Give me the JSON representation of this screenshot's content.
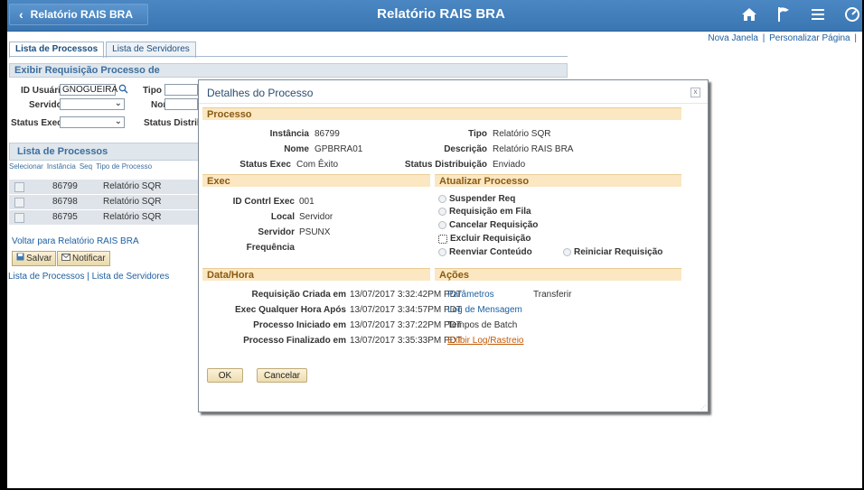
{
  "app": {
    "back_label": "Relatório RAIS BRA",
    "title": "Relatório RAIS BRA",
    "icons": [
      "home-icon",
      "flag-icon",
      "menu-icon",
      "navbar-icon"
    ]
  },
  "top_links": {
    "new_window": "Nova Janela",
    "separator": "|",
    "personalize": "Personalizar Página",
    "trailing": "|"
  },
  "tabs": [
    {
      "label": "Lista de Processos",
      "active": true
    },
    {
      "label": "Lista de Servidores",
      "active": false
    }
  ],
  "background_page": {
    "section_title": "Exibir Requisição Processo de",
    "fields": {
      "user_id_label": "ID Usuário",
      "user_id_value": "GNOGUEIRA",
      "type_label": "Tipo",
      "server_label": "Servidor",
      "name_label": "Nome",
      "status_exec_label": "Status Exec",
      "status_dist_label": "Status Distribu"
    },
    "list": {
      "title": "Lista de Processos",
      "columns": [
        "Selecionar",
        "Instância",
        "Seq",
        "Tipo de Processo"
      ],
      "rows": [
        {
          "instance": "86799",
          "type": "Relatório SQR"
        },
        {
          "instance": "86798",
          "type": "Relatório SQR"
        },
        {
          "instance": "86795",
          "type": "Relatório SQR"
        }
      ]
    },
    "back_link": "Voltar para Relatório RAIS BRA",
    "save_label": "Salvar",
    "notify_label": "Notificar",
    "bottom_links": "Lista de Processos | Lista de Servidores"
  },
  "modal": {
    "title": "Detalhes do Processo",
    "close": "x",
    "process": {
      "header": "Processo",
      "instance_label": "Instância",
      "instance_value": "86799",
      "type_label": "Tipo",
      "type_value": "Relatório SQR",
      "name_label": "Nome",
      "name_value": "GPBRRA01",
      "description_label": "Descrição",
      "description_value": "Relatório RAIS BRA",
      "status_exec_label": "Status Exec",
      "status_exec_value": "Com Êxito",
      "status_dist_label": "Status Distribuição",
      "status_dist_value": "Enviado"
    },
    "exec": {
      "header": "Exec",
      "id_label": "ID Contrl Exec",
      "id_value": "001",
      "local_label": "Local",
      "local_value": "Servidor",
      "server_label": "Servidor",
      "server_value": "PSUNX",
      "frequency_label": "Frequência",
      "frequency_value": ""
    },
    "update": {
      "header": "Atualizar Processo",
      "options": [
        "Suspender Req",
        "Requisição em Fila",
        "Cancelar Requisição",
        "Excluir Requisição",
        "Reenviar Conteúdo",
        "Reiniciar Requisição"
      ]
    },
    "datetime": {
      "header": "Data/Hora",
      "rows": [
        {
          "label": "Requisição Criada em",
          "value": "13/07/2017  3:32:42PM PDT"
        },
        {
          "label": "Exec Qualquer Hora Após",
          "value": "13/07/2017  3:34:57PM PDT"
        },
        {
          "label": "Processo Iniciado em",
          "value": "13/07/2017  3:37:22PM PDT"
        },
        {
          "label": "Processo Finalizado em",
          "value": "13/07/2017  3:35:33PM PDT"
        }
      ]
    },
    "actions": {
      "header": "Ações",
      "parameters": "Parâmetros",
      "transfer": "Transferir",
      "message_log": "Log de Mensagem",
      "batch_times": "Tempos de Batch",
      "view_log": "Exibir Log/Rastreio"
    },
    "ok_label": "OK",
    "cancel_label": "Cancelar"
  }
}
